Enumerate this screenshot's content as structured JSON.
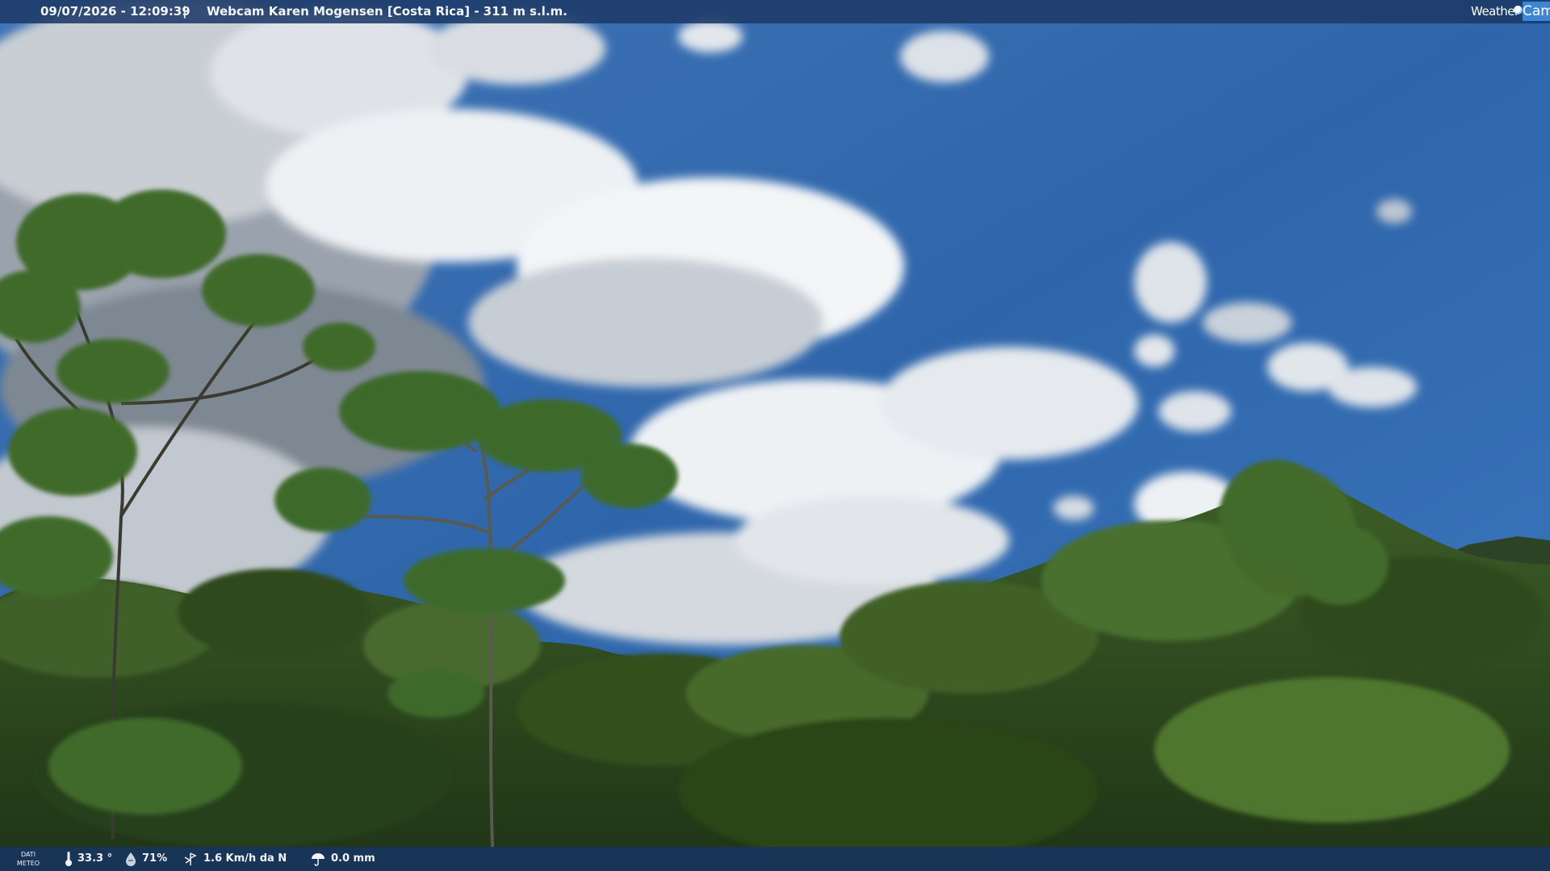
{
  "overlay": {
    "timestamp": "09/07/2026 - 12:09:39",
    "separator": "|",
    "title": "Webcam Karen Mogensen [Costa Rica]  - 311 m s.l.m."
  },
  "brand": {
    "weather": "Weather",
    "cam": "Cam"
  },
  "meteo": {
    "label_line1": "DATI",
    "label_line2": "METEO",
    "temperature": "33.3 °",
    "humidity": "71%",
    "wind": "1.6 Km/h da N",
    "rain": "0.0 mm"
  },
  "icons": [
    "thermometer-icon",
    "humidity-icon",
    "wind-icon",
    "rain-icon",
    "weather-logo-dot-icon"
  ],
  "colors": {
    "sky": "#2e64a8",
    "bar": "#1c3a68",
    "brand_accent": "#3d86d6",
    "foliage": "#2c4a1e"
  }
}
